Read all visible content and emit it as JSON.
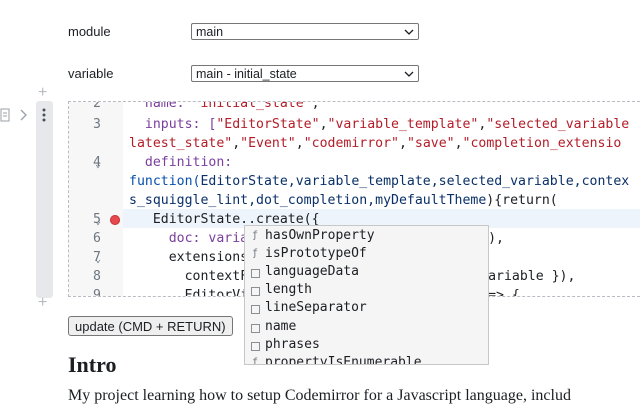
{
  "form": {
    "module_label": "module",
    "module_value": "main",
    "variable_label": "variable",
    "variable_value": "main - initial_state"
  },
  "cell_controls": {
    "add_above": "+",
    "add_below": "+"
  },
  "editor": {
    "lines": [
      {
        "num": "2",
        "fold": ""
      },
      {
        "num": "3",
        "fold": ""
      },
      {
        "num": "4",
        "fold": "⌄"
      },
      {
        "num": "5",
        "fold": "⌄"
      },
      {
        "num": "6",
        "fold": ""
      },
      {
        "num": "7",
        "fold": "⌄"
      },
      {
        "num": "8",
        "fold": ""
      },
      {
        "num": "9",
        "fold": ""
      }
    ],
    "code": {
      "l2a": "  name: ",
      "l2b": "\"initial_state\"",
      "l2c": ",",
      "l3a": "  inputs: [",
      "l3b": "\"EditorState\"",
      "l3c": ",",
      "l3d": "\"variable_template\"",
      "l3e": ",",
      "l3f": "\"selected_variable",
      "l3w_a": "latest_state\"",
      "l3w_b": ",",
      "l3w_c": "\"Event\"",
      "l3w_d": ",",
      "l3w_e": "\"codemirror\"",
      "l3w_f": ",",
      "l3w_g": "\"save\"",
      "l3w_h": ",",
      "l3w_i": "\"completion_extensio",
      "l4a": "  definition:",
      "l4w_a": "function(",
      "l4w_b": "EditorState,variable_template,selected_variable,contex",
      "l4w2": "s_squiggle_lint,dot_completion,myDefaultTheme",
      "l4w2b": "){return(",
      "l5": "   EditorState..create({",
      "l6a": "     doc: varia",
      "l6b": "),",
      "l7": "     extensions",
      "l8a": "       contextF",
      "l8b": "ariable }),",
      "l9a": "       EditorVi",
      "l9b": "=> {"
    }
  },
  "autocomplete": {
    "items": [
      {
        "icon": "ƒ",
        "kind": "function",
        "label": "hasOwnProperty"
      },
      {
        "icon": "ƒ",
        "kind": "function",
        "label": "isPrototypeOf"
      },
      {
        "icon": "",
        "kind": "property",
        "label": "languageData"
      },
      {
        "icon": "",
        "kind": "property",
        "label": "length"
      },
      {
        "icon": "",
        "kind": "property",
        "label": "lineSeparator"
      },
      {
        "icon": "",
        "kind": "property",
        "label": "name"
      },
      {
        "icon": "",
        "kind": "property",
        "label": "phrases"
      },
      {
        "icon": "ƒ",
        "kind": "function",
        "label": "propertyIsEnumerable"
      }
    ]
  },
  "update_button": "update (CMD + RETURN)",
  "section": {
    "heading": "Intro",
    "paragraph": "My project learning how to setup Codemirror for a Javascript language, includ"
  },
  "colors": {
    "breakpoint": "#e5484d",
    "string": "#b31d28",
    "property": "#7a3e9d",
    "variable": "#0a3069"
  }
}
